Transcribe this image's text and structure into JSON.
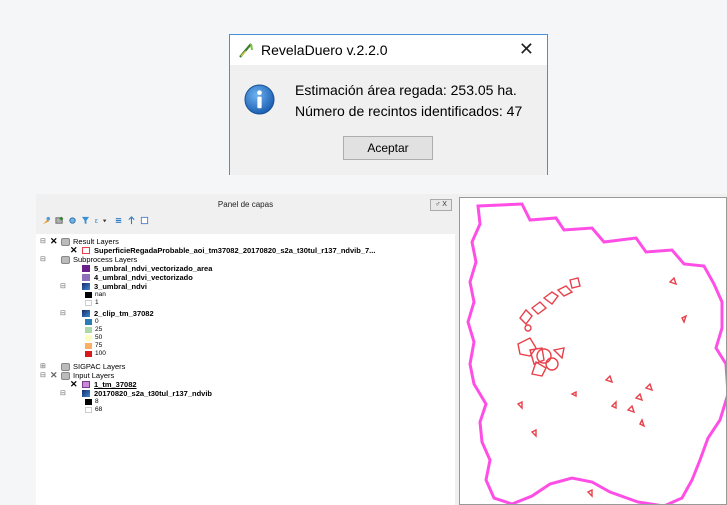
{
  "dialog": {
    "title": "RevelaDuero v.2.2.0",
    "close": "✕",
    "message_line1": "Estimación área regada: 253.05 ha.",
    "message_line2": "Número de recintos identificados: 47",
    "ok_button": "Aceptar"
  },
  "layers_panel": {
    "title": "Panel de capas",
    "float_label": "♂ X",
    "groups": {
      "result": {
        "label": "Result Layers",
        "layers": [
          {
            "label": "SuperficieRegadaProbable_aoi_tm37082_20170820_s2a_t30tul_r137_ndvib_7..."
          }
        ]
      },
      "subprocess": {
        "label": "Subprocess Layers",
        "layers": [
          {
            "label": "5_umbral_ndvi_vectorizado_area"
          },
          {
            "label": "4_umbral_ndvi_vectorizado"
          },
          {
            "label": "3_umbral_ndvi",
            "legend": [
              "nan",
              "1"
            ]
          },
          {
            "label": "2_clip_tm_37082",
            "legend": [
              "0",
              "25",
              "50",
              "75",
              "100"
            ]
          }
        ]
      },
      "sigpac": {
        "label": "SIGPAC Layers"
      },
      "input": {
        "label": "Input Layers",
        "layers": [
          {
            "label": "1_tm_37082"
          },
          {
            "label": "20170820_s2a_t30tul_r137_ndvib",
            "legend": [
              "8",
              "68"
            ]
          }
        ]
      }
    }
  },
  "colors": {
    "accent": "#4a90d9",
    "boundary": "#ff2fe0",
    "parcels": "#e8404a"
  }
}
